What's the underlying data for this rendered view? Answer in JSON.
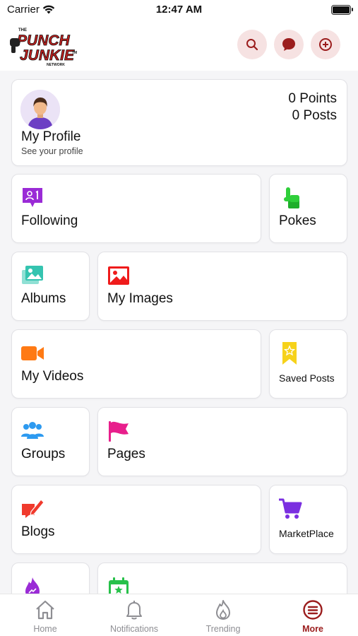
{
  "status_bar": {
    "carrier": "Carrier",
    "time": "12:47 AM"
  },
  "header": {
    "logo_alt": "The Punch Junkie Network"
  },
  "profile": {
    "name": "My Profile",
    "subtitle": "See your profile",
    "points": "0 Points",
    "posts": "0 Posts"
  },
  "menu": {
    "following": "Following",
    "pokes": "Pokes",
    "albums": "Albums",
    "my_images": "My Images",
    "my_videos": "My Videos",
    "saved_posts": "Saved Posts",
    "groups": "Groups",
    "pages": "Pages",
    "blogs": "Blogs",
    "marketplace": "MarketPlace"
  },
  "tabs": [
    {
      "label": "Home",
      "icon": "home-icon"
    },
    {
      "label": "Notifications",
      "icon": "bell-icon"
    },
    {
      "label": "Trending",
      "icon": "flame-icon"
    },
    {
      "label": "More",
      "icon": "menu-icon"
    }
  ],
  "colors": {
    "accent": "#9b1d1d",
    "header_button_bg": "#f6e2e2"
  }
}
